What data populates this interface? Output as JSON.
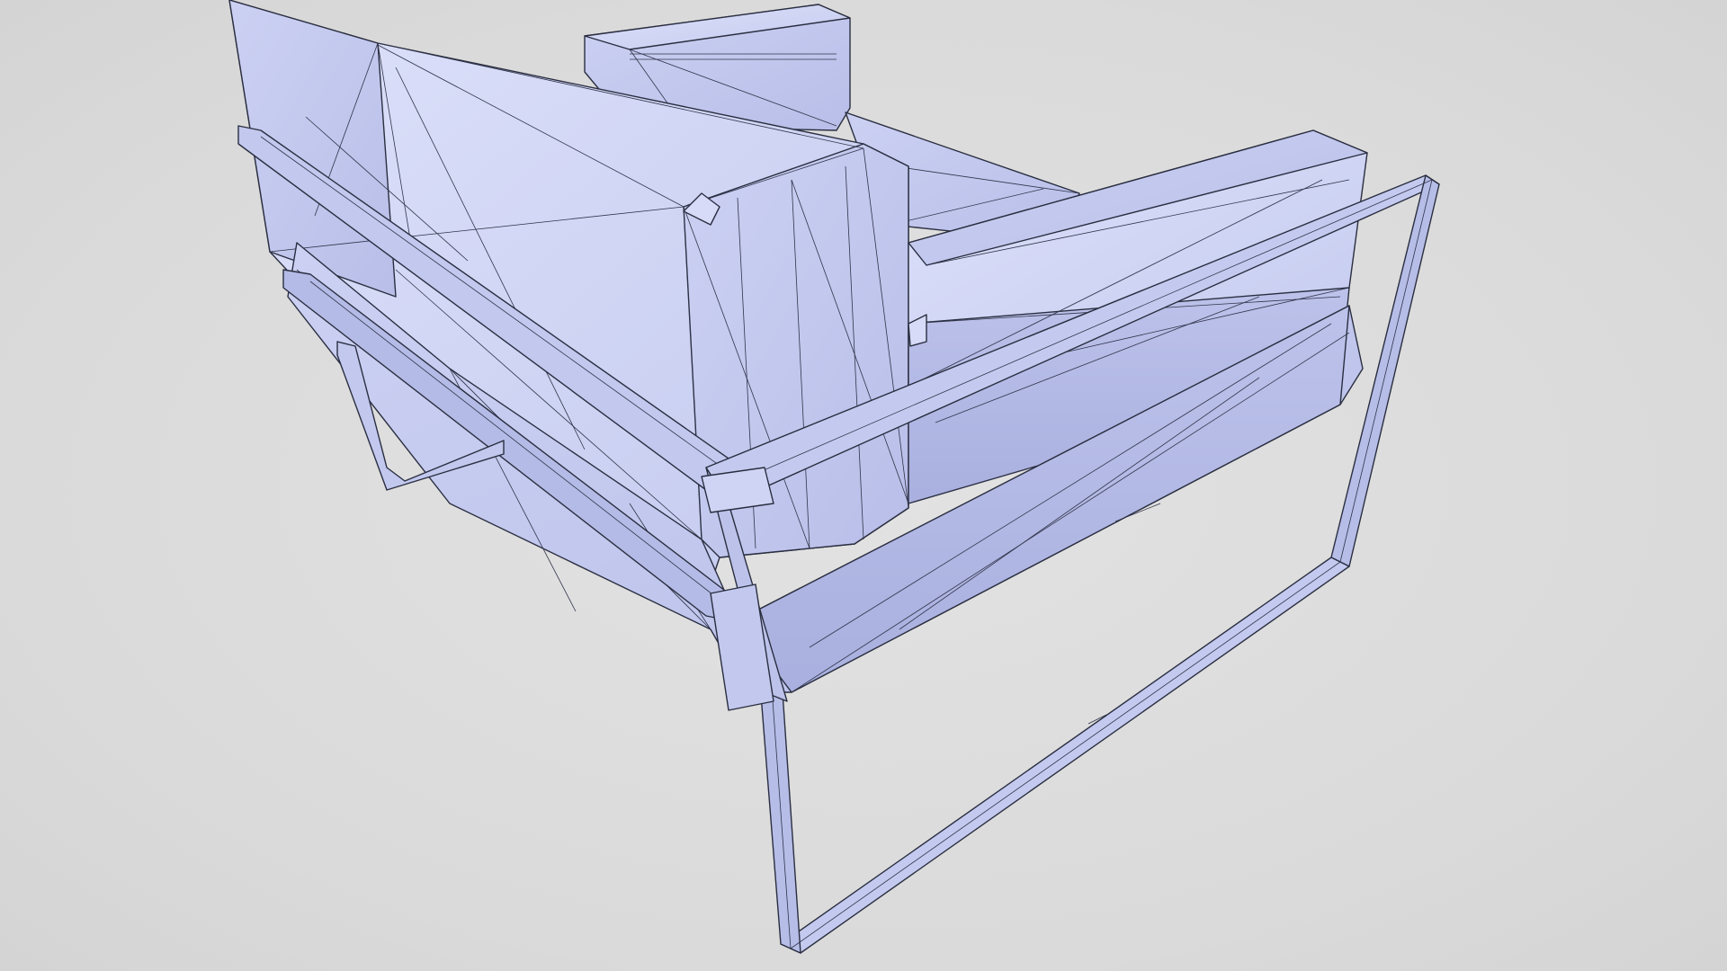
{
  "viewport": {
    "background_color": "#dcdcdc",
    "mesh_fill_light": "#d4d8f6",
    "mesh_fill_mid": "#c6cbef",
    "mesh_fill_dark": "#b3b9e4",
    "wire_color": "#2a2e40",
    "display_mode": "wireframe-on-shaded",
    "subject": "lounge-armchair-mesh"
  }
}
